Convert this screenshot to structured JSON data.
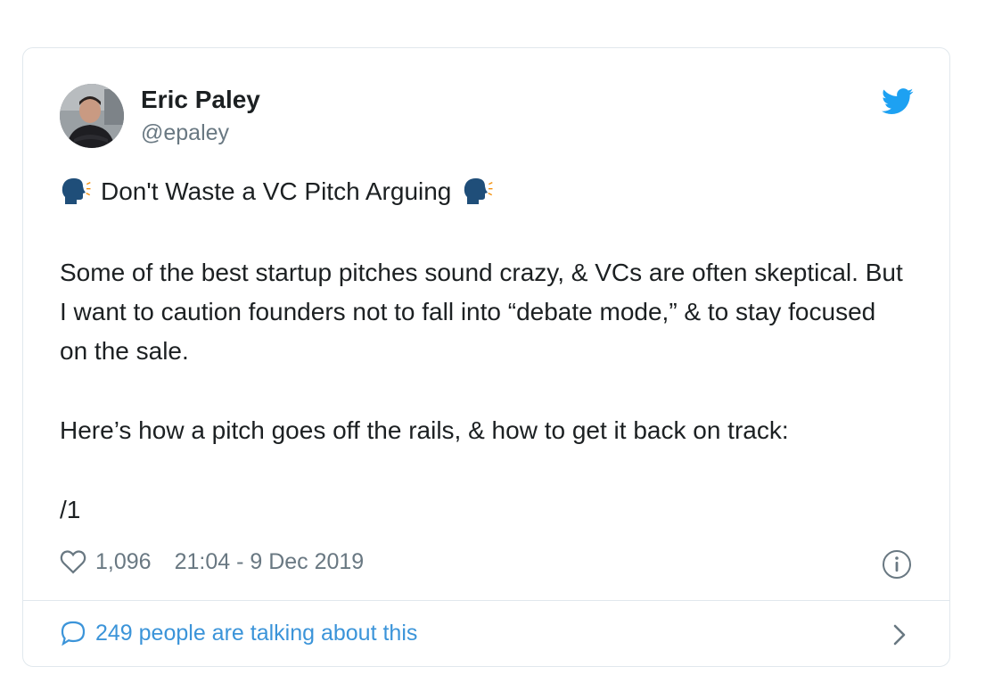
{
  "author": {
    "name": "Eric Paley",
    "handle": "@epaley"
  },
  "icons": {
    "avatar": "profile-photo",
    "brand": "twitter-bird-icon",
    "headline_emoji": "speaking-head-icon",
    "like": "heart-outline-icon",
    "info": "info-circle-icon",
    "reply": "speech-bubble-icon",
    "chevron": "chevron-right-icon"
  },
  "tweet": {
    "headline": "Don't Waste a VC Pitch Arguing",
    "paragraph1": "Some of the best startup pitches sound crazy, & VCs are often skeptical. But I want to caution founders not to fall into “debate mode,” & to stay focused on the sale.",
    "paragraph2": "Here’s how a pitch goes off the rails, & how to get it back on track:",
    "paragraph3": "/1"
  },
  "meta": {
    "likes": "1,096",
    "timestamp": "21:04 - 9 Dec 2019"
  },
  "footer": {
    "talking": "249 people are talking about this"
  },
  "colors": {
    "brand_blue": "#1da1f2",
    "link_blue": "#3b94d9",
    "muted_gray": "#697882",
    "border": "#e1e8ed",
    "text": "#1c2022"
  }
}
